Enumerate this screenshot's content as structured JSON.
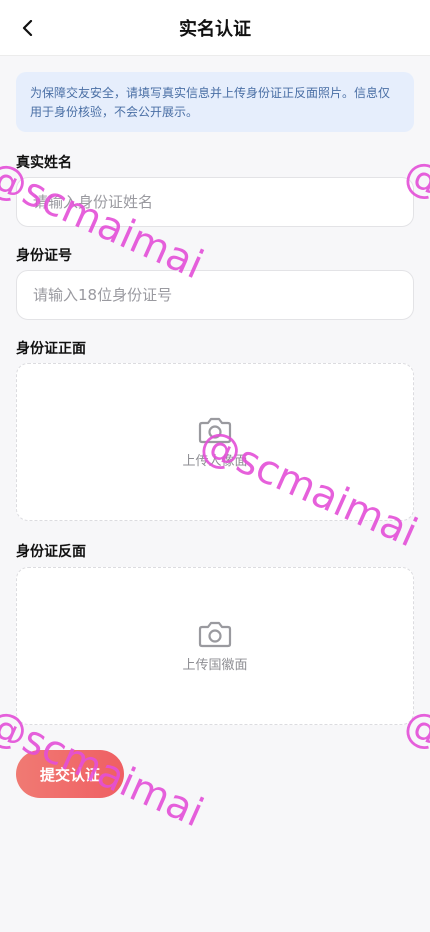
{
  "header": {
    "back_icon": "chevron-left-icon",
    "title": "实名认证"
  },
  "notice": {
    "text": "为保障交友安全，请填写真实信息并上传身份证正反面照片。信息仅用于身份核验，不会公开展示。"
  },
  "form": {
    "name": {
      "label": "真实姓名",
      "placeholder": "请输入身份证姓名",
      "value": ""
    },
    "id_number": {
      "label": "身份证号",
      "placeholder": "请输入18位身份证号",
      "value": ""
    },
    "front": {
      "label": "身份证正面",
      "hint": "上传人像面",
      "icon": "camera-icon"
    },
    "back": {
      "label": "身份证反面",
      "hint": "上传国徽面",
      "icon": "camera-icon"
    },
    "submit_label": "提交认证"
  },
  "watermark": {
    "text": "@scmaimai",
    "color": "#e44fd8"
  },
  "colors": {
    "notice_bg": "#e6eefc",
    "notice_text": "#4a6fa5",
    "submit_gradient_start": "#f07a73",
    "submit_gradient_end": "#ef5f63"
  }
}
